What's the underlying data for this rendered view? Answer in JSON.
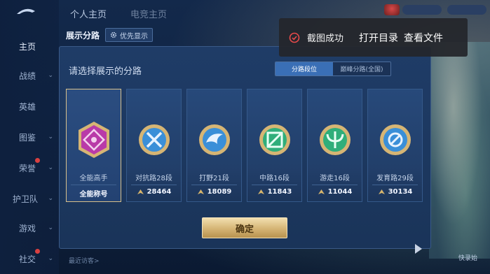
{
  "sidebar": {
    "items": [
      {
        "label": "主页",
        "chevron": false,
        "dot": false
      },
      {
        "label": "战绩",
        "chevron": true,
        "dot": false
      },
      {
        "label": "英雄",
        "chevron": false,
        "dot": false
      },
      {
        "label": "图鉴",
        "chevron": true,
        "dot": false
      },
      {
        "label": "荣誉",
        "chevron": true,
        "dot": true
      },
      {
        "label": "护卫队",
        "chevron": true,
        "dot": false
      },
      {
        "label": "游戏",
        "chevron": true,
        "dot": false
      },
      {
        "label": "社交",
        "chevron": true,
        "dot": true
      }
    ]
  },
  "top_tabs": {
    "personal": "个人主页",
    "esports": "电竞主页"
  },
  "dialog": {
    "title": "展示分路",
    "priority_label": "优先显示",
    "prompt": "请选择展示的分路",
    "segment": {
      "left": "分路段位",
      "right": "巅峰分路(全国)"
    },
    "cards": [
      {
        "name": "全能高手",
        "tag": "全能称号",
        "score": null,
        "color": "#b93aa8"
      },
      {
        "name": "对抗路28段",
        "tag": null,
        "score": "28464",
        "color": "#3a8fd8"
      },
      {
        "name": "打野21段",
        "tag": null,
        "score": "18089",
        "color": "#3a8fd8"
      },
      {
        "name": "中路16段",
        "tag": null,
        "score": "11843",
        "color": "#2fae7a"
      },
      {
        "name": "游走16段",
        "tag": null,
        "score": "11044",
        "color": "#2fae7a"
      },
      {
        "name": "发育路29段",
        "tag": null,
        "score": "30134",
        "color": "#3a8fd8"
      }
    ],
    "confirm": "确定"
  },
  "toast": {
    "message": "截图成功",
    "open_dir": "打开目录",
    "view_file": "查看文件"
  },
  "bottom": {
    "label": "最近访客>",
    "corner": "快录始"
  },
  "colors": {
    "accent": "#3a6fb6",
    "gold": "#d5b474",
    "toast_icon": "#e84a4a"
  }
}
